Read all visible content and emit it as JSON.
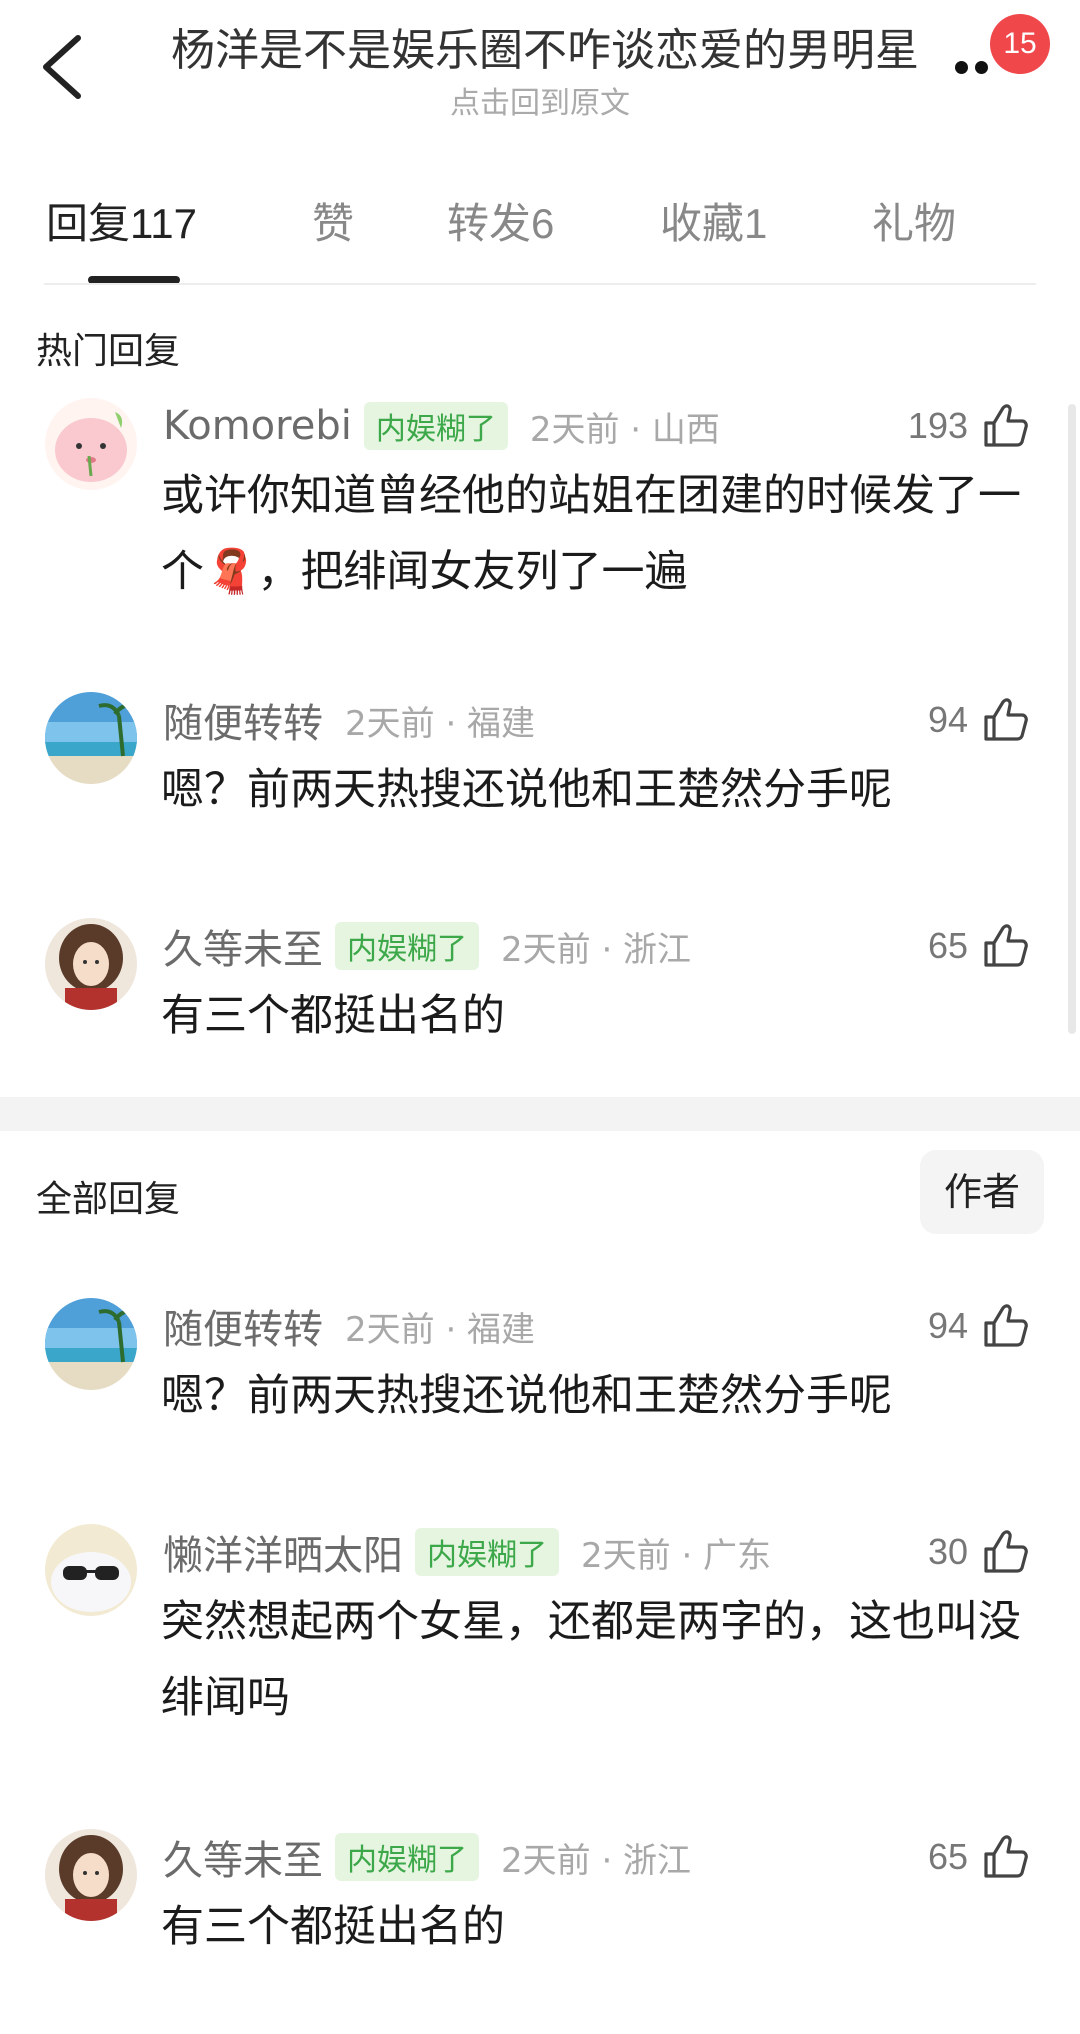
{
  "header": {
    "title": "杨洋是不是娱乐圈不咋谈恋爱的男明星",
    "subtitle": "点击回到原文",
    "badge_count": "15"
  },
  "tabs": [
    {
      "label": "回复",
      "count": "117"
    },
    {
      "label": "赞",
      "count": ""
    },
    {
      "label": "转发",
      "count": "6"
    },
    {
      "label": "收藏",
      "count": "1"
    },
    {
      "label": "礼物",
      "count": ""
    }
  ],
  "hot_section": {
    "title": "热门回复"
  },
  "all_section": {
    "title": "全部回复",
    "filter_button": "作者"
  },
  "hot_comments": [
    {
      "username": "Komorebi",
      "tag": "内娱糊了",
      "time": "2天前 · 山西",
      "likes": "193",
      "text": "或许你知道曾经他的站姐在团建的时候发了一个🧣，把绯闻女友列了一遍"
    },
    {
      "username": "随便转转",
      "tag": "",
      "time": "2天前 · 福建",
      "likes": "94",
      "text": "嗯？前两天热搜还说他和王楚然分手呢"
    },
    {
      "username": "久等未至",
      "tag": "内娱糊了",
      "time": "2天前 · 浙江",
      "likes": "65",
      "text": "有三个都挺出名的"
    }
  ],
  "all_comments": [
    {
      "username": "随便转转",
      "tag": "",
      "time": "2天前 · 福建",
      "likes": "94",
      "text": "嗯？前两天热搜还说他和王楚然分手呢"
    },
    {
      "username": "懒洋洋晒太阳",
      "tag": "内娱糊了",
      "time": "2天前 · 广东",
      "likes": "30",
      "text": "突然想起两个女星，还都是两字的，这也叫没绯闻吗"
    },
    {
      "username": "久等未至",
      "tag": "内娱糊了",
      "time": "2天前 · 浙江",
      "likes": "65",
      "text": "有三个都挺出名的"
    }
  ],
  "colors": {
    "tag_bg": "#e5f5e0",
    "tag_text": "#3da84a",
    "badge": "#f0474b"
  },
  "icons": [
    "back-arrow-icon",
    "more-icon",
    "thumbs-up-icon"
  ]
}
